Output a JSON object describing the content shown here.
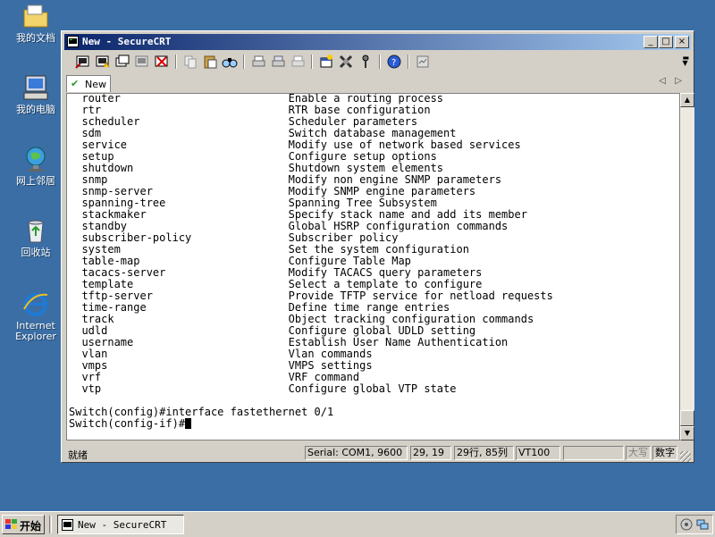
{
  "desktop": {
    "icons": [
      {
        "label": "我的文档",
        "icon": "my-documents-folder-icon"
      },
      {
        "label": "我的电脑",
        "icon": "my-computer-icon"
      },
      {
        "label": "网上邻居",
        "icon": "network-places-icon"
      },
      {
        "label": "回收站",
        "icon": "recycle-bin-icon"
      },
      {
        "label": "Internet Explorer",
        "icon": "internet-explorer-icon"
      }
    ]
  },
  "window": {
    "title": "New - SecureCRT",
    "controls": [
      "_",
      "□",
      "×"
    ]
  },
  "toolbar": {
    "buttons": [
      "connect-icon",
      "quick-connect-icon",
      "connect-tab-icon",
      "reconnect-icon",
      "disconnect-icon",
      "copy-icon",
      "paste-icon",
      "find-icon",
      "print-icon",
      "print-selection-icon",
      "print-setup-icon",
      "session-options-icon",
      "global-options-icon",
      "keymap-icon",
      "help-icon",
      "sftp-icon"
    ]
  },
  "tab": {
    "label": "New"
  },
  "terminal": {
    "commands": [
      {
        "cmd": "router",
        "desc": "Enable a routing process"
      },
      {
        "cmd": "rtr",
        "desc": "RTR base configuration"
      },
      {
        "cmd": "scheduler",
        "desc": "Scheduler parameters"
      },
      {
        "cmd": "sdm",
        "desc": "Switch database management"
      },
      {
        "cmd": "service",
        "desc": "Modify use of network based services"
      },
      {
        "cmd": "setup",
        "desc": "Configure setup options"
      },
      {
        "cmd": "shutdown",
        "desc": "Shutdown system elements"
      },
      {
        "cmd": "snmp",
        "desc": "Modify non engine SNMP parameters"
      },
      {
        "cmd": "snmp-server",
        "desc": "Modify SNMP engine parameters"
      },
      {
        "cmd": "spanning-tree",
        "desc": "Spanning Tree Subsystem"
      },
      {
        "cmd": "stackmaker",
        "desc": "Specify stack name and add its member"
      },
      {
        "cmd": "standby",
        "desc": "Global HSRP configuration commands"
      },
      {
        "cmd": "subscriber-policy",
        "desc": "Subscriber policy"
      },
      {
        "cmd": "system",
        "desc": "Set the system configuration"
      },
      {
        "cmd": "table-map",
        "desc": "Configure Table Map"
      },
      {
        "cmd": "tacacs-server",
        "desc": "Modify TACACS query parameters"
      },
      {
        "cmd": "template",
        "desc": "Select a template to configure"
      },
      {
        "cmd": "tftp-server",
        "desc": "Provide TFTP service for netload requests"
      },
      {
        "cmd": "time-range",
        "desc": "Define time range entries"
      },
      {
        "cmd": "track",
        "desc": "Object tracking configuration commands"
      },
      {
        "cmd": "udld",
        "desc": "Configure global UDLD setting"
      },
      {
        "cmd": "username",
        "desc": "Establish User Name Authentication"
      },
      {
        "cmd": "vlan",
        "desc": "Vlan commands"
      },
      {
        "cmd": "vmps",
        "desc": "VMPS settings"
      },
      {
        "cmd": "vrf",
        "desc": "VRF command"
      },
      {
        "cmd": "vtp",
        "desc": "Configure global VTP state"
      }
    ],
    "prompt_lines": [
      "Switch(config)#interface fastethernet 0/1",
      "Switch(config-if)#"
    ]
  },
  "statusbar": {
    "status": "就绪",
    "serial": "Serial: COM1, 9600",
    "cursor_pos": "29, 19",
    "rows_cols": "29行, 85列",
    "terminal_type": "VT100",
    "blank": "",
    "caps": "大写",
    "num": "数字"
  },
  "taskbar": {
    "start_label": "开始",
    "task_title": "New - SecureCRT"
  },
  "colors": {
    "desktop": "#3a6ea5",
    "titlebar_start": "#0a246a",
    "titlebar_end": "#a6caf0",
    "chrome": "#d4d0c8"
  }
}
